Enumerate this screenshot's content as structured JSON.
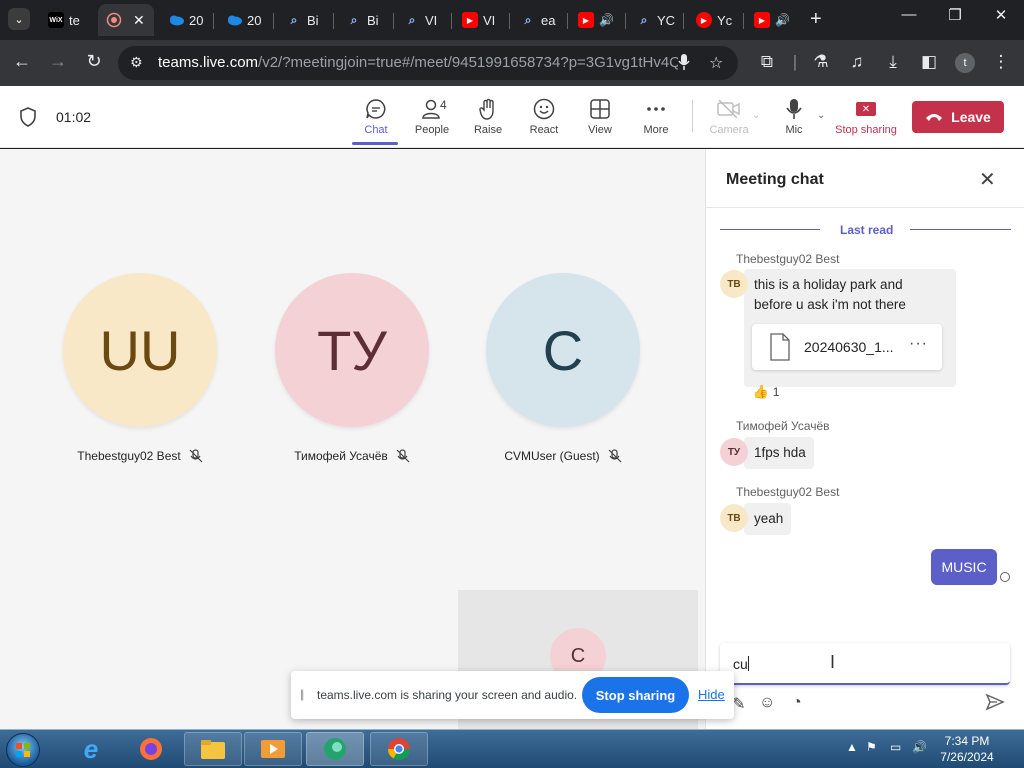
{
  "browser": {
    "tabs": [
      {
        "title": "te",
        "favicon": "wix-icon",
        "fav_text": "WiX",
        "fav_color": "#000000"
      },
      {
        "title": "",
        "favicon": "recording-icon",
        "active": true,
        "close": "✕"
      },
      {
        "title": "20",
        "favicon": "onedrive-icon"
      },
      {
        "title": "20",
        "favicon": "onedrive-icon"
      },
      {
        "title": "Bi",
        "favicon": "search-icon"
      },
      {
        "title": "Bi",
        "favicon": "search-icon"
      },
      {
        "title": "VI",
        "favicon": "search-icon"
      },
      {
        "title": "VI",
        "favicon": "youtube-icon"
      },
      {
        "title": "ea",
        "favicon": "search-icon"
      },
      {
        "title": "",
        "favicon": "youtube-audio-icon"
      },
      {
        "title": "YC",
        "favicon": "search-icon"
      },
      {
        "title": "Yc",
        "favicon": "youtube-music-icon"
      },
      {
        "title": "",
        "favicon": "youtube-audio-icon"
      }
    ],
    "new_tab": "+",
    "url_host": "teams.live.com",
    "url_path": "/v2/?meetingjoin=true#/meet/9451991658734?p=3G1vg1tHv4Q6...",
    "profile_initial": "t"
  },
  "meeting": {
    "timer": "01:02",
    "buttons": {
      "chat": "Chat",
      "people": "People",
      "people_count": "4",
      "raise": "Raise",
      "react": "React",
      "view": "View",
      "more": "More",
      "camera": "Camera",
      "mic": "Mic",
      "stop_sharing": "Stop sharing",
      "leave": "Leave"
    }
  },
  "participants": [
    {
      "initials": "UU",
      "name": "Thebestguy02 Best",
      "bg": "#f9e8c8",
      "fg": "#6b4a12"
    },
    {
      "initials": "ТУ",
      "name": "Тимофей Усачёв",
      "bg": "#f4d1d5",
      "fg": "#5c2e37"
    },
    {
      "initials": "C",
      "name": "CVMUser (Guest)",
      "bg": "#d6e4ec",
      "fg": "#23404f"
    }
  ],
  "self_tile": {
    "initial": "C"
  },
  "share_banner": {
    "text": "teams.live.com is sharing your screen and audio.",
    "stop": "Stop sharing",
    "hide": "Hide"
  },
  "chat": {
    "title": "Meeting chat",
    "last_read": "Last read",
    "messages": [
      {
        "sender": "Thebestguy02 Best",
        "initials": "TB",
        "lines": [
          "this is  a holiday park and",
          "before u ask i'm not there"
        ]
      },
      {
        "sender": "Тимофей Усачёв",
        "initials": "ТУ",
        "text": "1fps hda"
      },
      {
        "sender": "Thebestguy02 Best",
        "initials": "TB",
        "text": "yeah"
      }
    ],
    "file_name": "20240630_1...",
    "reaction_count": "1",
    "my_message": "MUSIC",
    "compose_text": "cu"
  },
  "taskbar": {
    "time": "7:34 PM",
    "date": "7/26/2024"
  },
  "colors": {
    "teams_purple": "#5b5fc7",
    "leave_red": "#c4314b",
    "chrome_blue": "#1a73e8"
  }
}
